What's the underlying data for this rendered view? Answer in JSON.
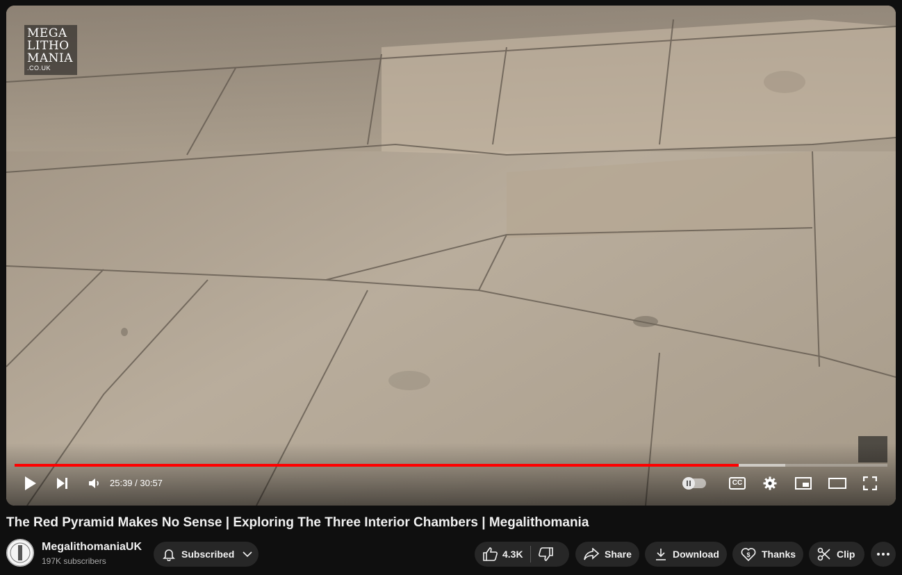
{
  "player": {
    "logo_top_left": {
      "line1": "MEGA",
      "line2": "LITHO",
      "line3": "MANIA",
      "line4": ".CO.UK"
    },
    "current_time": "25:39",
    "duration": "30:57",
    "time_display": "25:39 / 30:57",
    "progress_fraction": 0.83,
    "buffered_fraction": 0.883,
    "accent_color": "#ff0000",
    "controls": {
      "play": "play-icon",
      "next": "next-icon",
      "volume": "volume-icon",
      "autoplay": "autoplay-toggle",
      "subtitles": "CC",
      "settings": "gear-icon",
      "miniplayer": "miniplayer-icon",
      "theater": "theater-icon",
      "fullscreen": "fullscreen-icon"
    }
  },
  "video": {
    "title": "The Red Pyramid Makes No Sense | Exploring The Three Interior Chambers | Megalithomania"
  },
  "channel": {
    "name": "MegalithomaniaUK",
    "subscribers": "197K subscribers",
    "subscribe_label": "Subscribed"
  },
  "actions": {
    "likes": "4.3K",
    "share": "Share",
    "download": "Download",
    "thanks": "Thanks",
    "clip": "Clip"
  }
}
